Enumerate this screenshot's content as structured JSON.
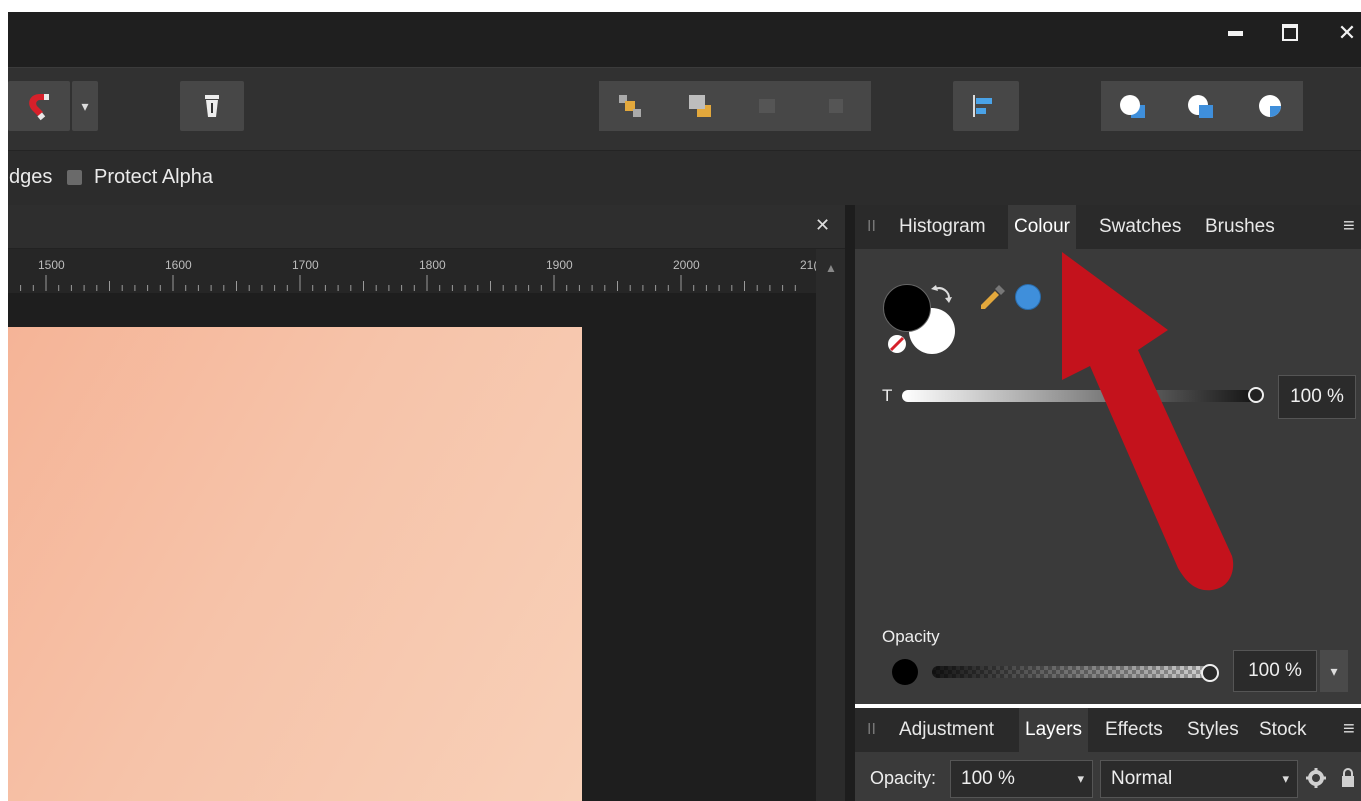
{
  "window": {
    "minimize_icon": "minimize-icon",
    "maximize_icon": "maximize-icon",
    "close_icon": "close-icon",
    "minimize_glyph": "▁",
    "maximize_glyph": "▢",
    "close_glyph": "✕"
  },
  "toolbar": {
    "snapping_icon": "magnet-icon",
    "dropdown_glyph": "▾",
    "icons": [
      "magnet-icon",
      "dropdown-icon",
      "trash-icon",
      "arrange-back-icon",
      "arrange-forward-icon",
      "arrange-disabled-icon",
      "arrange-disabled-icon",
      "align-left-icon",
      "boolean-add-icon",
      "boolean-subtract-icon",
      "boolean-intersect-icon"
    ]
  },
  "context": {
    "edges_label": "dges",
    "protect_alpha_label": "Protect Alpha"
  },
  "document": {
    "close_glyph": "✕",
    "ruler_ticks": [
      "1500",
      "1600",
      "1700",
      "1800",
      "1900",
      "2000",
      "21("
    ],
    "scroll_up_glyph": "▲"
  },
  "colour_panel": {
    "grip": "II",
    "tabs": [
      "Histogram",
      "Colour",
      "Swatches",
      "Brushes"
    ],
    "active_tab": "Colour",
    "menu_glyph": "≡",
    "tint_label": "T",
    "tint_value": "100 %",
    "opacity_label": "Opacity",
    "opacity_value": "100 %",
    "dropdown_glyph": "▾",
    "primary_color": "#000000",
    "secondary_color": "#ffffff",
    "picked_color": "#3f8fdb"
  },
  "layers_panel": {
    "grip": "II",
    "tabs": [
      "Adjustment",
      "Layers",
      "Effects",
      "Styles",
      "Stock"
    ],
    "active_tab": "Layers",
    "menu_glyph": "≡",
    "opacity_label": "Opacity:",
    "opacity_value": "100 %",
    "blend_mode": "Normal",
    "dropdown_glyph": "▾",
    "settings_icon": "gear-icon",
    "lock_icon": "lock-icon"
  },
  "annotation": {
    "arrow_color": "#c4121c"
  }
}
